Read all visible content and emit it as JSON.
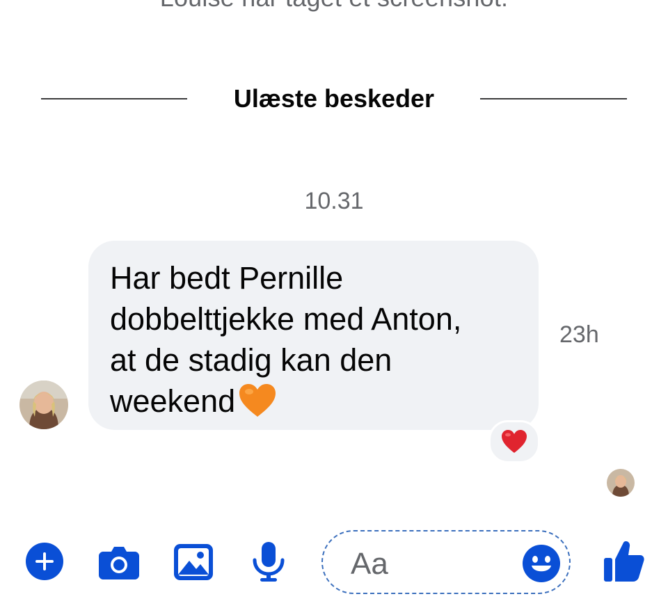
{
  "system_note": "Louise har taget et screenshot.",
  "unread_divider": {
    "label": "Ulæste beskeder"
  },
  "thread_timestamp": "10.31",
  "message": {
    "text": "Har bedt Pernille\ndobbelttjekke med Anton,\nat de stadig kan den\nweekend",
    "trailing_emoji": "orange-heart",
    "sent_ago": "23h",
    "reaction": "red-heart"
  },
  "composer": {
    "placeholder": "Aa",
    "actions": [
      "plus-icon",
      "camera-icon",
      "image-icon",
      "microphone-icon"
    ],
    "emoji_button": "smiley-icon",
    "send_button": "thumbs-up-icon"
  },
  "colors": {
    "accent": "#0a4fd6",
    "bubble": "#f0f2f5",
    "muted_text": "#65676b",
    "orange_heart": "#f5891f",
    "red_heart": "#e0242f"
  }
}
